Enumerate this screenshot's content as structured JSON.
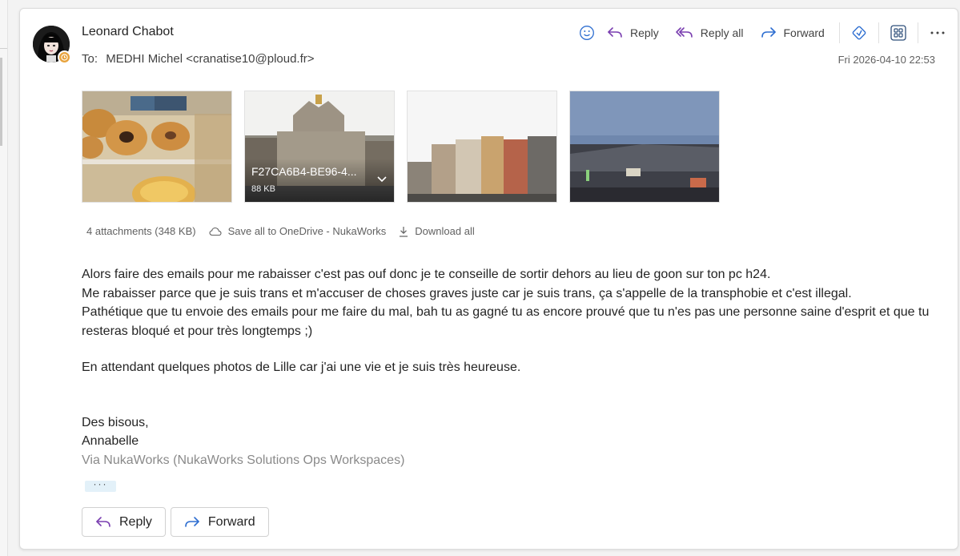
{
  "header": {
    "sender_name": "Leonard Chabot",
    "to_label": "To:",
    "recipient": "MEDHI Michel <cranatise10@ploud.fr>",
    "date": "Fri 2026-04-10 22:53"
  },
  "toolbar": {
    "reply_label": "Reply",
    "reply_all_label": "Reply all",
    "forward_label": "Forward"
  },
  "attachments": {
    "items": [
      {
        "thumb": "pastry-display"
      },
      {
        "thumb": "lille-grand-place",
        "name": "F27CA6B4-BE96-4...",
        "size": "88 KB"
      },
      {
        "thumb": "flemish-facades"
      },
      {
        "thumb": "evening-building"
      }
    ],
    "summary": "4 attachments (348 KB)",
    "save_label": "Save all to OneDrive - NukaWorks",
    "download_label": "Download all"
  },
  "body": {
    "line1": "Alors faire des emails pour me rabaisser c'est pas ouf donc je te conseille de sortir dehors au lieu de goon sur ton pc h24.",
    "line2": "Me rabaisser parce que je suis trans et m'accuser de choses graves juste car je suis trans, ça s'appelle de la transphobie et c'est illegal.",
    "line3": "Pathétique que tu envoie des emails pour me faire du mal, bah tu as gagné tu as encore prouvé que tu n'es pas une personne saine d'esprit et que tu resteras bloqué et pour très longtemps ;)",
    "line4": "En attendant quelques photos de Lille car j'ai une vie et je suis très heureuse.",
    "closing": "Des bisous,",
    "signature": "Annabelle",
    "via": "Via NukaWorks (NukaWorks Solutions Ops Workspaces)"
  },
  "footer": {
    "ellipsis": "···",
    "reply_label": "Reply",
    "forward_label": "Forward"
  },
  "colors": {
    "accent_purple": "#7a3fb0",
    "accent_blue": "#2f6fd1",
    "presence": "#e8a33d"
  }
}
